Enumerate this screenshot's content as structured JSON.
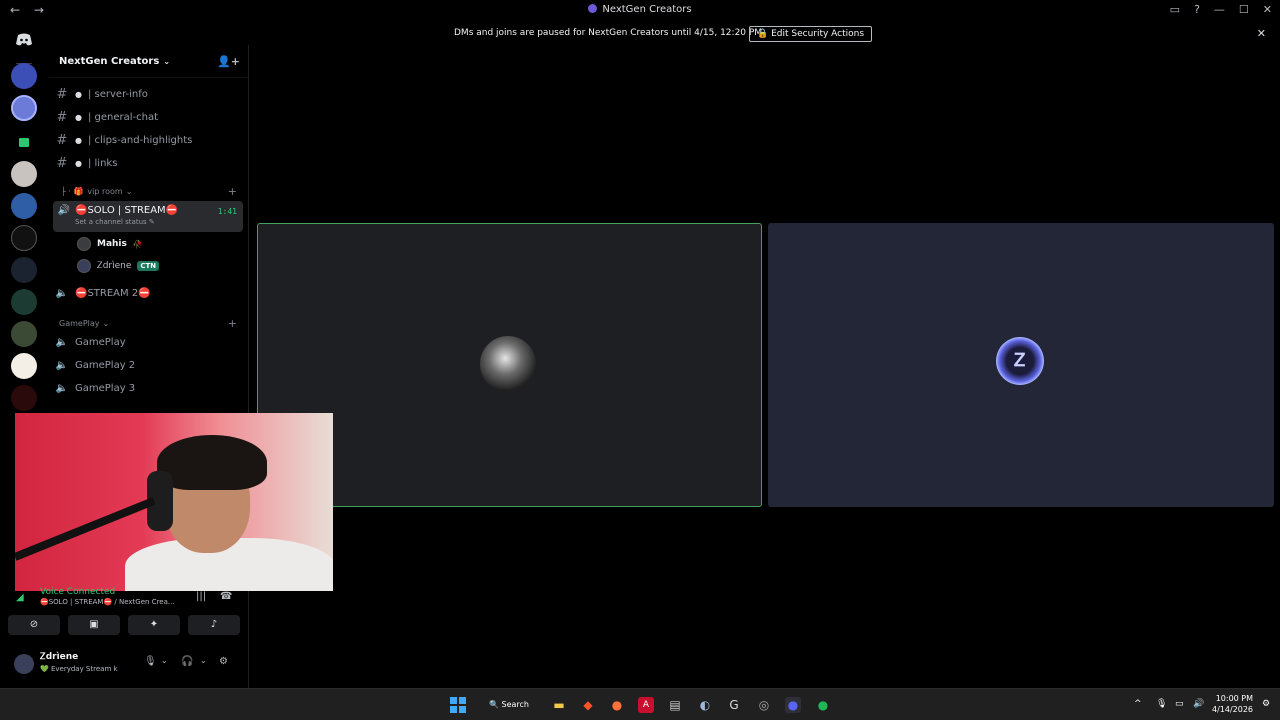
{
  "window": {
    "title": "NextGen Creators",
    "nav_back": "←",
    "nav_forward": "→",
    "controls": [
      "▭",
      "?",
      "—",
      "☐",
      "✕"
    ]
  },
  "notice": {
    "message": "DMs and joins are paused for NextGen Creators until 4/15, 12:20 PM",
    "button": "Edit Security Actions",
    "close": "✕"
  },
  "server": {
    "name": "NextGen Creators",
    "chevron": "⌄",
    "invite_icon": "👤+"
  },
  "text_channels": [
    {
      "name": "| server-info"
    },
    {
      "name": "| general-chat"
    },
    {
      "name": "| clips-and-highlights"
    },
    {
      "name": "| links"
    }
  ],
  "vip_category": {
    "label": "vip room",
    "plus": "+"
  },
  "voice_active": {
    "name": "⛔SOLO | STREAM⛔",
    "timer": "1:41",
    "status_hint": "Set a channel status ✎",
    "users": [
      {
        "name": "Mahis",
        "badge": ""
      },
      {
        "name": "Ꮓdrìene",
        "badge": "CTN"
      }
    ]
  },
  "voice_channel_2": "⛔STREAM 2⛔",
  "gameplay_category": {
    "label": "GamePlay",
    "plus": "+",
    "channels": [
      "GamePlay",
      "GamePlay 2",
      "GamePlay 3"
    ]
  },
  "voice_panel": {
    "connected": "Voice Connected",
    "location": "⛔SOLO | STREAM⛔ / NextGen Crea..."
  },
  "user": {
    "name": "Ꮓdrìene",
    "status": "💚 Everyday Stream k"
  },
  "taskbar": {
    "search_label": "Search",
    "time": "10:00 PM",
    "date": "4/14/2026"
  }
}
